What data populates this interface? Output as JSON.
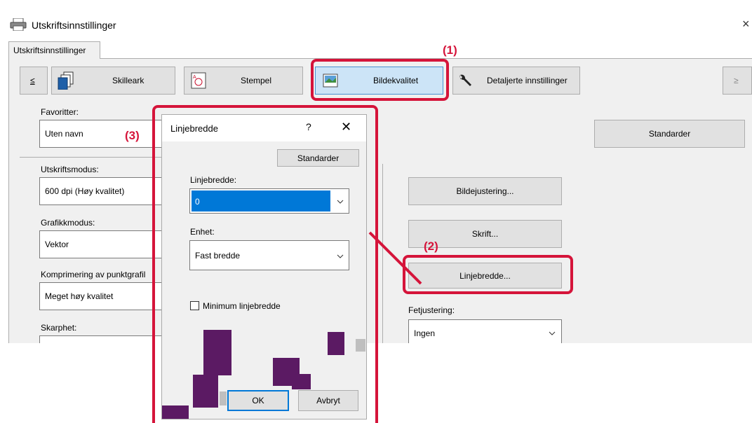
{
  "window": {
    "title": "Utskriftsinnstillinger",
    "close": "×"
  },
  "tab": {
    "label": "Utskriftsinnstillinger"
  },
  "nav": {
    "prev": "≤",
    "next": "≥",
    "buttons": [
      "Skilleark",
      "Stempel",
      "Bildekvalitet",
      "Detaljerte innstillinger"
    ]
  },
  "favorites": {
    "label": "Favoritter:",
    "value": "Uten navn",
    "defaults_button": "Standarder"
  },
  "left_fields": [
    {
      "label": "Utskriftsmodus:",
      "value": "600 dpi (Høy kvalitet)"
    },
    {
      "label": "Grafikkmodus:",
      "value": "Vektor"
    },
    {
      "label": "Komprimering av punktgrafil",
      "value": "Meget høy kvalitet"
    },
    {
      "label": "Skarphet:",
      "value": ""
    }
  ],
  "right_buttons": {
    "image_adjust": "Bildejustering...",
    "font": "Skrift...",
    "line_width": "Linjebredde..."
  },
  "fit": {
    "label": "Fetjustering:",
    "value": "Ingen"
  },
  "callouts": {
    "c1": "(1)",
    "c2": "(2)",
    "c3": "(3)"
  },
  "dialog": {
    "title": "Linjebredde",
    "help": "?",
    "close": "✕",
    "defaults_button": "Standarder",
    "line_width_label": "Linjebredde:",
    "line_width_value": "0",
    "unit_label": "Enhet:",
    "unit_value": "Fast bredde",
    "min_checkbox_label": "Minimum linjebredde",
    "ok": "OK",
    "cancel": "Avbryt"
  },
  "colors": {
    "accent_red": "#d5143a",
    "selection_blue": "#0078d7",
    "dither_purple": "#5b1a63"
  }
}
